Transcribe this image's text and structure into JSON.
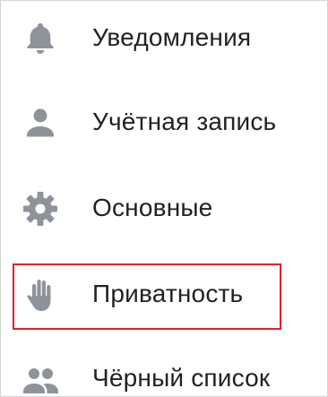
{
  "settings_menu": {
    "items": [
      {
        "id": "notifications",
        "label": "Уведомления",
        "icon": "bell-icon"
      },
      {
        "id": "account",
        "label": "Учётная запись",
        "icon": "person-icon"
      },
      {
        "id": "general",
        "label": "Основные",
        "icon": "gear-icon"
      },
      {
        "id": "privacy",
        "label": "Приватность",
        "icon": "hand-icon"
      },
      {
        "id": "blacklist",
        "label": "Чёрный список",
        "icon": "people-icon"
      }
    ],
    "icon_color": "#8e939a",
    "text_color": "#222222",
    "highlighted_item": "privacy",
    "highlight_color": "#e4202b"
  }
}
